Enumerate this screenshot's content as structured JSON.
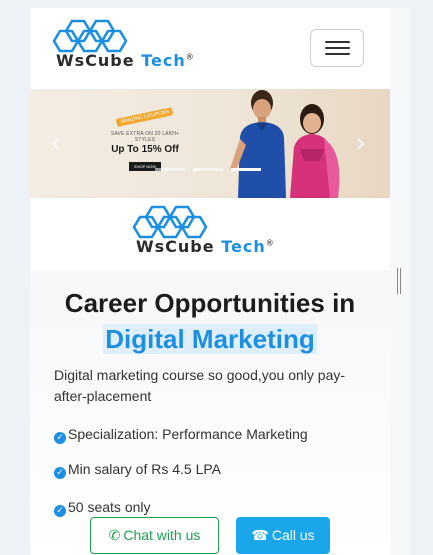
{
  "navbar": {
    "brand": {
      "name": "WsCube",
      "accent": "Tech",
      "reg": "®"
    },
    "menu_icon": "hamburger-menu-icon"
  },
  "banner": {
    "tag": "AMAZING COUPONS",
    "line1": "SAVE EXTRA ON 20 LAKH+ STYLES",
    "headline": "Up To 15% Off",
    "cta": "SHOP NOW",
    "prev_icon": "chevron-left-icon",
    "next_icon": "chevron-right-icon",
    "active_slide": 3
  },
  "logo_strip": {
    "brand": {
      "name": "WsCube",
      "accent": "Tech",
      "reg": "®"
    }
  },
  "hero": {
    "title_line1": "Career Opportunities in",
    "title_line2": "Digital Marketing",
    "description": "Digital marketing course so good,you only pay-after-placement",
    "features": [
      "Specialization: Performance Marketing",
      "Min salary of Rs 4.5 LPA",
      "50 seats only"
    ]
  },
  "cta": {
    "chat_label": "Chat with us",
    "call_label": "Call us",
    "chat_icon": "whatsapp-icon",
    "call_icon": "phone-icon"
  },
  "colors": {
    "accent": "#1d8fe0",
    "chat": "#1f9e50",
    "call": "#1aa6ea"
  }
}
